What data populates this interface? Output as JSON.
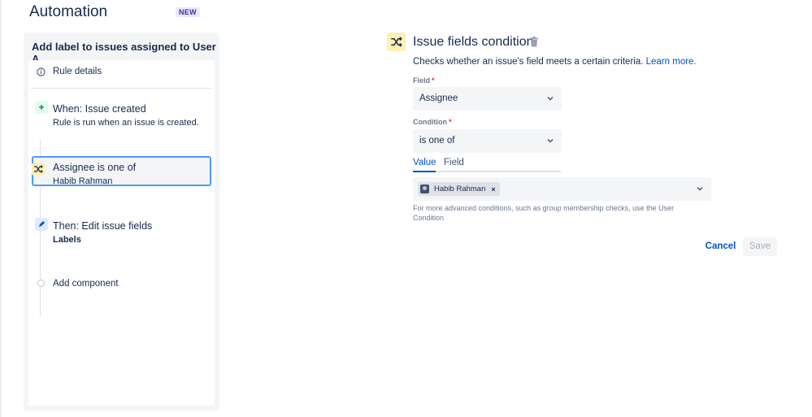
{
  "header": {
    "title": "Automation",
    "badge": "NEW"
  },
  "rule": {
    "title": "Add label to issues assigned to User A",
    "details_label": "Rule details",
    "trigger": {
      "title": "When: Issue created",
      "subtitle": "Rule is run when an issue is created."
    },
    "condition": {
      "title": "Assignee is one of",
      "subtitle": "Habib Rahman"
    },
    "action": {
      "title": "Then: Edit issue fields",
      "subtitle": "Labels"
    },
    "add_component": "Add component"
  },
  "condition_panel": {
    "title": "Issue fields condition",
    "description": "Checks whether an issue's field meets a certain criteria.",
    "learn_more": "Learn more.",
    "field_label": "Field",
    "field_value": "Assignee",
    "condition_label": "Condition",
    "condition_value": "is one of",
    "required_marker": "*",
    "tabs": [
      {
        "label": "Value",
        "active": true
      },
      {
        "label": "Field",
        "active": false
      }
    ],
    "value_chip": {
      "label": "Habib Rahman",
      "remove": "×"
    },
    "helper_text": "For more advanced conditions, such as group membership checks, use the User Condition",
    "cancel_label": "Cancel",
    "save_label": "Save"
  },
  "colors": {
    "accent": "#0052cc",
    "selected_border": "#4c9aff",
    "condition_icon_bg": "#fff0b3",
    "trigger_icon_bg": "#e3fcef",
    "action_icon_bg": "#deebff"
  },
  "icons": [
    "info-icon",
    "plus-icon",
    "shuffle-icon",
    "pencil-icon",
    "trash-icon",
    "chevron-down-icon",
    "remove-icon",
    "avatar"
  ]
}
